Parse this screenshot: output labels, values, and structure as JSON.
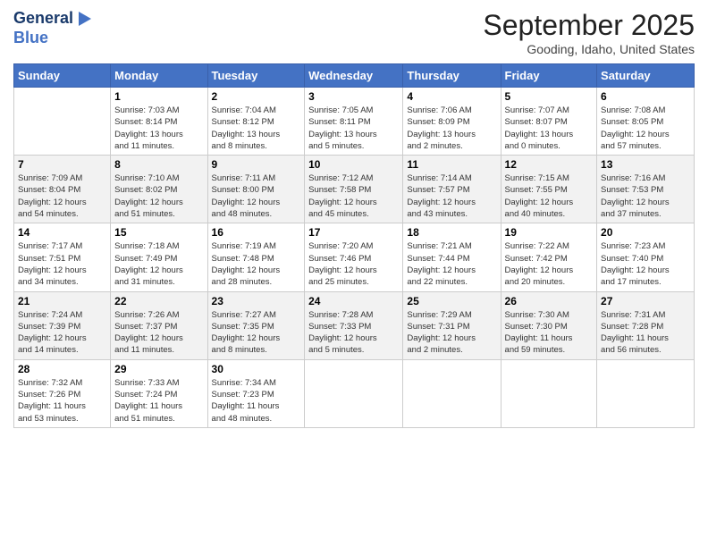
{
  "header": {
    "logo_line1": "General",
    "logo_line2": "Blue",
    "month_title": "September 2025",
    "location": "Gooding, Idaho, United States"
  },
  "days_of_week": [
    "Sunday",
    "Monday",
    "Tuesday",
    "Wednesday",
    "Thursday",
    "Friday",
    "Saturday"
  ],
  "weeks": [
    [
      {
        "day": "",
        "info": ""
      },
      {
        "day": "1",
        "info": "Sunrise: 7:03 AM\nSunset: 8:14 PM\nDaylight: 13 hours\nand 11 minutes."
      },
      {
        "day": "2",
        "info": "Sunrise: 7:04 AM\nSunset: 8:12 PM\nDaylight: 13 hours\nand 8 minutes."
      },
      {
        "day": "3",
        "info": "Sunrise: 7:05 AM\nSunset: 8:11 PM\nDaylight: 13 hours\nand 5 minutes."
      },
      {
        "day": "4",
        "info": "Sunrise: 7:06 AM\nSunset: 8:09 PM\nDaylight: 13 hours\nand 2 minutes."
      },
      {
        "day": "5",
        "info": "Sunrise: 7:07 AM\nSunset: 8:07 PM\nDaylight: 13 hours\nand 0 minutes."
      },
      {
        "day": "6",
        "info": "Sunrise: 7:08 AM\nSunset: 8:05 PM\nDaylight: 12 hours\nand 57 minutes."
      }
    ],
    [
      {
        "day": "7",
        "info": "Sunrise: 7:09 AM\nSunset: 8:04 PM\nDaylight: 12 hours\nand 54 minutes."
      },
      {
        "day": "8",
        "info": "Sunrise: 7:10 AM\nSunset: 8:02 PM\nDaylight: 12 hours\nand 51 minutes."
      },
      {
        "day": "9",
        "info": "Sunrise: 7:11 AM\nSunset: 8:00 PM\nDaylight: 12 hours\nand 48 minutes."
      },
      {
        "day": "10",
        "info": "Sunrise: 7:12 AM\nSunset: 7:58 PM\nDaylight: 12 hours\nand 45 minutes."
      },
      {
        "day": "11",
        "info": "Sunrise: 7:14 AM\nSunset: 7:57 PM\nDaylight: 12 hours\nand 43 minutes."
      },
      {
        "day": "12",
        "info": "Sunrise: 7:15 AM\nSunset: 7:55 PM\nDaylight: 12 hours\nand 40 minutes."
      },
      {
        "day": "13",
        "info": "Sunrise: 7:16 AM\nSunset: 7:53 PM\nDaylight: 12 hours\nand 37 minutes."
      }
    ],
    [
      {
        "day": "14",
        "info": "Sunrise: 7:17 AM\nSunset: 7:51 PM\nDaylight: 12 hours\nand 34 minutes."
      },
      {
        "day": "15",
        "info": "Sunrise: 7:18 AM\nSunset: 7:49 PM\nDaylight: 12 hours\nand 31 minutes."
      },
      {
        "day": "16",
        "info": "Sunrise: 7:19 AM\nSunset: 7:48 PM\nDaylight: 12 hours\nand 28 minutes."
      },
      {
        "day": "17",
        "info": "Sunrise: 7:20 AM\nSunset: 7:46 PM\nDaylight: 12 hours\nand 25 minutes."
      },
      {
        "day": "18",
        "info": "Sunrise: 7:21 AM\nSunset: 7:44 PM\nDaylight: 12 hours\nand 22 minutes."
      },
      {
        "day": "19",
        "info": "Sunrise: 7:22 AM\nSunset: 7:42 PM\nDaylight: 12 hours\nand 20 minutes."
      },
      {
        "day": "20",
        "info": "Sunrise: 7:23 AM\nSunset: 7:40 PM\nDaylight: 12 hours\nand 17 minutes."
      }
    ],
    [
      {
        "day": "21",
        "info": "Sunrise: 7:24 AM\nSunset: 7:39 PM\nDaylight: 12 hours\nand 14 minutes."
      },
      {
        "day": "22",
        "info": "Sunrise: 7:26 AM\nSunset: 7:37 PM\nDaylight: 12 hours\nand 11 minutes."
      },
      {
        "day": "23",
        "info": "Sunrise: 7:27 AM\nSunset: 7:35 PM\nDaylight: 12 hours\nand 8 minutes."
      },
      {
        "day": "24",
        "info": "Sunrise: 7:28 AM\nSunset: 7:33 PM\nDaylight: 12 hours\nand 5 minutes."
      },
      {
        "day": "25",
        "info": "Sunrise: 7:29 AM\nSunset: 7:31 PM\nDaylight: 12 hours\nand 2 minutes."
      },
      {
        "day": "26",
        "info": "Sunrise: 7:30 AM\nSunset: 7:30 PM\nDaylight: 11 hours\nand 59 minutes."
      },
      {
        "day": "27",
        "info": "Sunrise: 7:31 AM\nSunset: 7:28 PM\nDaylight: 11 hours\nand 56 minutes."
      }
    ],
    [
      {
        "day": "28",
        "info": "Sunrise: 7:32 AM\nSunset: 7:26 PM\nDaylight: 11 hours\nand 53 minutes."
      },
      {
        "day": "29",
        "info": "Sunrise: 7:33 AM\nSunset: 7:24 PM\nDaylight: 11 hours\nand 51 minutes."
      },
      {
        "day": "30",
        "info": "Sunrise: 7:34 AM\nSunset: 7:23 PM\nDaylight: 11 hours\nand 48 minutes."
      },
      {
        "day": "",
        "info": ""
      },
      {
        "day": "",
        "info": ""
      },
      {
        "day": "",
        "info": ""
      },
      {
        "day": "",
        "info": ""
      }
    ]
  ]
}
